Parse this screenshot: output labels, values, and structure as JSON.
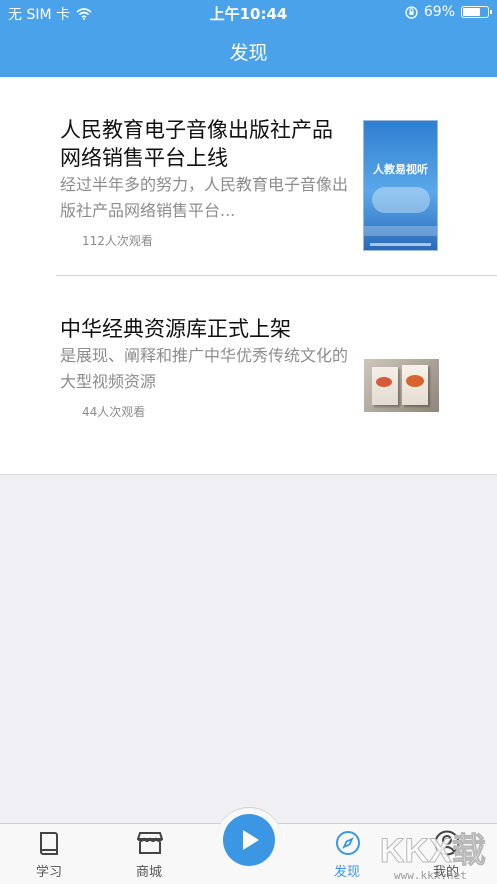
{
  "status_bar": {
    "carrier": "无 SIM 卡",
    "time": "上午10:44",
    "battery_percent": "69%",
    "battery_level": 0.69,
    "icons": [
      "wifi-icon",
      "orientation-lock-icon",
      "battery-icon"
    ]
  },
  "nav": {
    "title": "发现"
  },
  "items": [
    {
      "title": "人民教育电子音像出版社产品网络销售平台上线",
      "description": "经过半年多的努力，人民教育电子音像出版社产品网络销售平台...",
      "views": "112人次观看",
      "thumbnail_text": "人教易视听"
    },
    {
      "title": "中华经典资源库正式上架",
      "description": "是展现、阐释和推广中华优秀传统文化的大型视频资源",
      "views": "44人次观看"
    }
  ],
  "tabbar": {
    "tabs": [
      {
        "label": "学习",
        "icon": "book-icon"
      },
      {
        "label": "商城",
        "icon": "store-icon"
      },
      {
        "label": "发现",
        "icon": "compass-icon",
        "active": true
      },
      {
        "label": "我的",
        "icon": "user-icon"
      }
    ],
    "center_icon": "play-icon"
  },
  "watermark": {
    "text": "www.kkx.net"
  },
  "colors": {
    "primary": "#4aa3ea",
    "active_tab": "#3b97e3",
    "background": "#efeff4",
    "secondary_text": "#8c8c8c"
  }
}
